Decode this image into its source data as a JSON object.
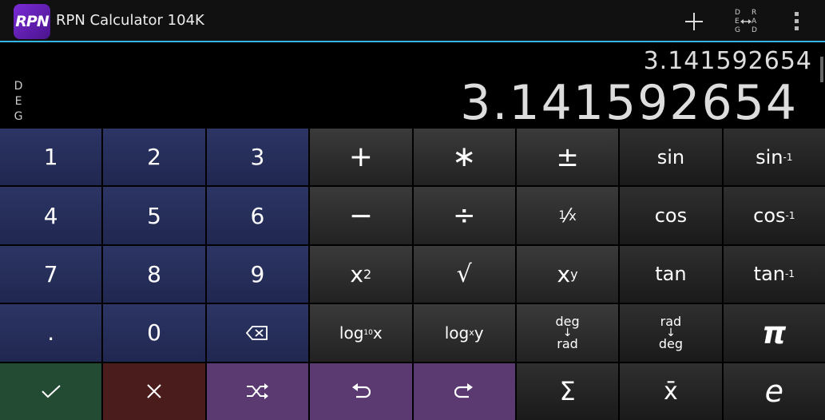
{
  "app": {
    "title": "RPN Calculator 104K",
    "logo_text": "RPN"
  },
  "actionbar": {
    "add_icon": "plus-icon",
    "degrad_icon": "deg-rad-toggle-icon",
    "degrad_letters": {
      "d1": "D",
      "e": "E",
      "g": "G",
      "r": "R",
      "a": "A",
      "d2": "D"
    },
    "overflow_icon": "overflow-menu-icon"
  },
  "display": {
    "mode": [
      "D",
      "E",
      "G"
    ],
    "stack_y": "3.141592654",
    "stack_x": "3.141592654"
  },
  "keys": {
    "row1": {
      "k1": "1",
      "k2": "2",
      "k3": "3",
      "plus": "+",
      "times": "∗",
      "negate": "±",
      "sin": "sin",
      "asin_base": "sin",
      "asin_sup": "-1"
    },
    "row2": {
      "k4": "4",
      "k5": "5",
      "k6": "6",
      "minus": "−",
      "divide": "÷",
      "recip_num": "1",
      "recip_den": "x",
      "cos": "cos",
      "acos_base": "cos",
      "acos_sup": "-1"
    },
    "row3": {
      "k7": "7",
      "k8": "8",
      "k9": "9",
      "square_base": "x",
      "square_sup": "2",
      "sqrt": "√",
      "power_base": "x",
      "power_sup": "y",
      "tan": "tan",
      "atan_base": "tan",
      "atan_sup": "-1"
    },
    "row4": {
      "dot": ".",
      "k0": "0",
      "backspace_icon": "backspace-icon",
      "log10_base": "log",
      "log10_sub": "10",
      "log10_arg": "x",
      "logxy_base": "log",
      "logxy_sub": "x",
      "logxy_arg": "y",
      "d2r_top": "deg",
      "d2r_arrow": "↓",
      "d2r_bottom": "rad",
      "r2d_top": "rad",
      "r2d_arrow": "↓",
      "r2d_bottom": "deg",
      "pi": "π"
    },
    "row5": {
      "ok_icon": "check-icon",
      "cancel_icon": "close-icon",
      "swap_icon": "shuffle-icon",
      "undo_icon": "undo-icon",
      "redo_icon": "redo-icon",
      "sum": "Σ",
      "mean": "x̄",
      "e": "e"
    }
  },
  "colors": {
    "accent": "#33b5e5",
    "numeric_key": "#2c3564",
    "ok_key": "#234a33",
    "cancel_key": "#4a1c1c",
    "purple_key": "#5a3a70"
  }
}
